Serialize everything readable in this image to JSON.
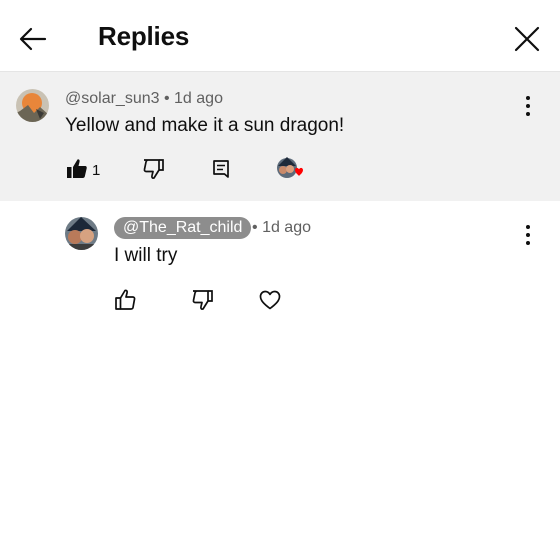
{
  "header": {
    "title": "Replies"
  },
  "icons": {
    "back": "arrow-left-icon",
    "close": "close-icon",
    "more": "more-vert-icon",
    "like": "thumb-up-icon",
    "dislike": "thumb-down-icon",
    "reply": "comment-icon",
    "heart": "heart-icon"
  },
  "colors": {
    "highlight_bg": "#f1f1f1",
    "badge_bg": "#8d8d8d",
    "heart_red": "#ff0000"
  },
  "comment": {
    "handle": "@solar_sun3",
    "separator": "•",
    "time": "1d ago",
    "text": "Yellow and make it a sun dragon!",
    "like_count": "1",
    "liked": true,
    "creator_hearted": true
  },
  "reply": {
    "handle": "@The_Rat_child",
    "separator": "•",
    "time": "1d ago",
    "text": "I will try"
  }
}
